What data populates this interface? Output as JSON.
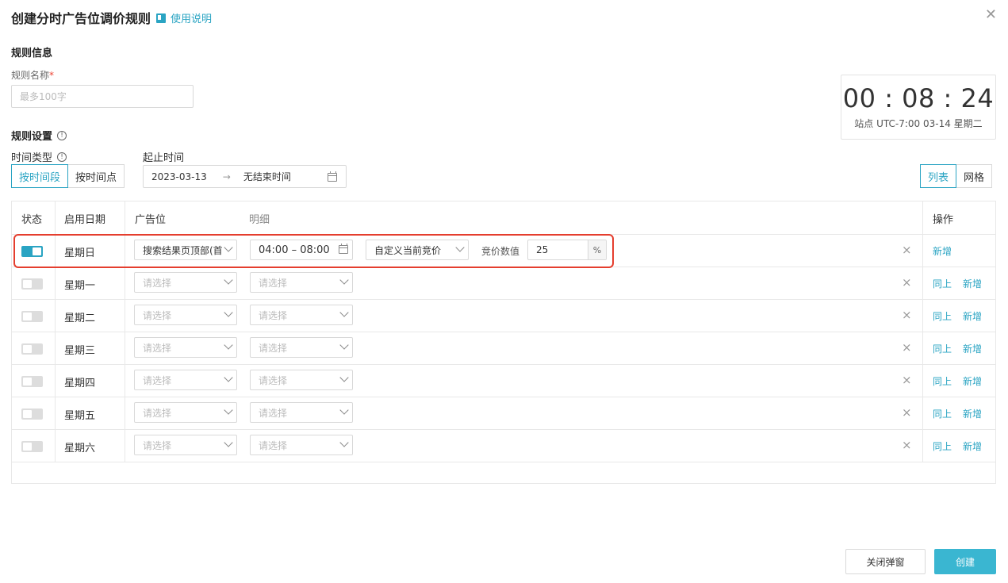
{
  "header": {
    "title": "创建分时广告位调价规则",
    "help_link": "使用说明"
  },
  "rule_info": {
    "section_title": "规则信息",
    "name_label": "规则名称",
    "required_mark": "*",
    "name_placeholder": "最多100字"
  },
  "clock": {
    "time": "00 : 08 : 24",
    "site_info": "站点 UTC-7:00   03-14 星期二"
  },
  "rule_settings": {
    "section_title": "规则设置",
    "time_type_label": "时间类型",
    "time_type_options": [
      "按时间段",
      "按时间点"
    ],
    "time_type_selected": "按时间段",
    "range_label": "起止时间",
    "start_date": "2023-03-13",
    "range_arrow": "→",
    "end_date": "无结束时间"
  },
  "view_toggle": {
    "options": [
      "列表",
      "网格"
    ],
    "selected": "列表"
  },
  "table": {
    "columns": [
      "状态",
      "启用日期",
      "广告位",
      "明细",
      "操作"
    ],
    "placeholder": "请选择",
    "rows": [
      {
        "enabled": true,
        "day": "星期日",
        "ad_slot": "搜索结果页顶部(首",
        "time_range": "04:00 – 08:00",
        "strategy": "自定义当前竞价",
        "bid_label": "竞价数值",
        "bid_value": "25",
        "bid_unit": "%",
        "ops": [
          "新增"
        ]
      },
      {
        "enabled": false,
        "day": "星期一",
        "ops": [
          "同上",
          "新增"
        ]
      },
      {
        "enabled": false,
        "day": "星期二",
        "ops": [
          "同上",
          "新增"
        ]
      },
      {
        "enabled": false,
        "day": "星期三",
        "ops": [
          "同上",
          "新增"
        ]
      },
      {
        "enabled": false,
        "day": "星期四",
        "ops": [
          "同上",
          "新增"
        ]
      },
      {
        "enabled": false,
        "day": "星期五",
        "ops": [
          "同上",
          "新增"
        ]
      },
      {
        "enabled": false,
        "day": "星期六",
        "ops": [
          "同上",
          "新增"
        ]
      }
    ],
    "remove_glyph": "×"
  },
  "footer": {
    "close_label": "关闭弹窗",
    "create_label": "创建"
  },
  "colors": {
    "accent": "#2aa4c3",
    "highlight": "#e53e2e",
    "primary_button": "#3ab6d1"
  }
}
